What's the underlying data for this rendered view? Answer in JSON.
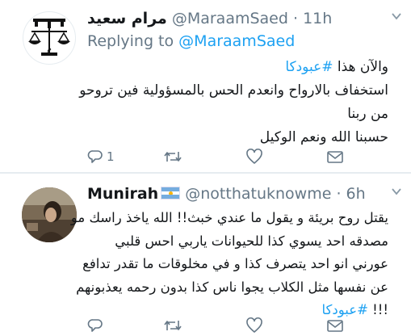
{
  "tweets": [
    {
      "name": "مرام سعيد",
      "handle": "@MaraamSaed",
      "separator": "·",
      "time": "11h",
      "replying_to_label": "Replying to",
      "replying_to_handle": "@MaraamSaed",
      "avatar_icon": "scales-of-justice-logo",
      "body_lines": [
        {
          "text": "والآن هذا ",
          "hashtag": "#عبودكا"
        },
        {
          "text": "استخفاف بالارواح وانعدم الحس بالمسؤولية فين تروحو"
        },
        {
          "text": "من ربنا"
        },
        {
          "text": "حسبنا الله ونعم الوكيل"
        }
      ],
      "actions": {
        "reply_count": "1",
        "retweet_count": "",
        "like_count": ""
      }
    },
    {
      "name": "Munirah",
      "flag_icon": "argentina-flag",
      "handle": "@notthatuknowme",
      "separator": "·",
      "time": "6h",
      "avatar_icon": "user-photo",
      "body_lines": [
        {
          "text": "يقتل روح بريئة و يقول ما عندي خبث!! الله ياخذ راسك مو"
        },
        {
          "text": "مصدقه احد يسوي كذا للحيوانات ياربي احس قلبي"
        },
        {
          "text": "عورني انو احد يتصرف كذا و في مخلوقات ما تقدر تدافع"
        },
        {
          "text": "عن نفسها مثل الكلاب يجوا ناس كذا بدون رحمه يعذبونهم"
        },
        {
          "text": "!!! ",
          "hashtag": "#عبودكا"
        }
      ],
      "actions": {
        "reply_count": "",
        "retweet_count": "",
        "like_count": ""
      }
    }
  ],
  "colors": {
    "link": "#1da1f2",
    "secondary": "#657786",
    "text": "#14171a",
    "divider": "#e6ecf0"
  }
}
